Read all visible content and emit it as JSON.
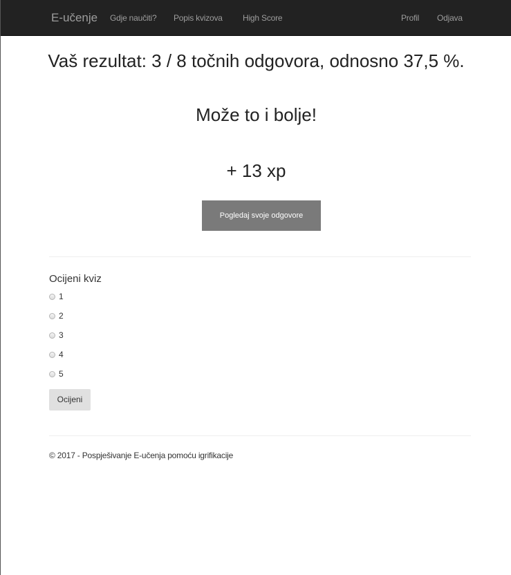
{
  "navbar": {
    "brand": "E-učenje",
    "links": [
      "Gdje naučiti?",
      "Popis kvizova",
      "High Score"
    ],
    "right_links": [
      "Profil",
      "Odjava"
    ]
  },
  "result": {
    "score_text": "Vaš rezultat: 3 / 8 točnih odgovora, odnosno 37,5 %.",
    "message": "Može to i bolje!",
    "xp": "+ 13 xp",
    "view_answers_label": "Pogledaj svoje odgovore"
  },
  "rating": {
    "title": "Ocijeni kviz",
    "options": [
      "1",
      "2",
      "3",
      "4",
      "5"
    ],
    "submit_label": "Ocijeni"
  },
  "footer": {
    "text": "© 2017 - Pospješivanje E-učenja pomoću igrifikacije"
  }
}
